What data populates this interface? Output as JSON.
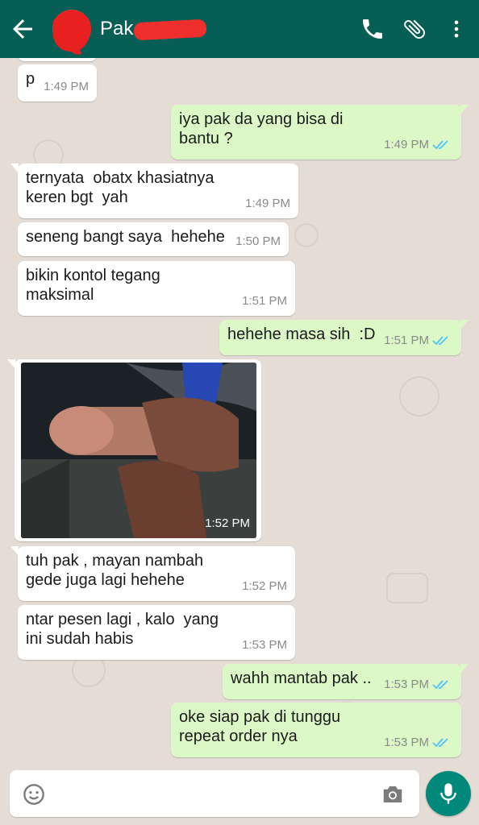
{
  "header": {
    "title": "Pak",
    "bg_color": "#075e54",
    "icons": [
      "back-arrow-icon",
      "call-icon",
      "attach-icon",
      "more-vert-icon"
    ]
  },
  "messages": [
    {
      "dir": "in",
      "text": "",
      "time": ""
    },
    {
      "dir": "in",
      "text": "p",
      "time": "1:49 PM"
    },
    {
      "dir": "out",
      "text": "iya pak da yang bisa di\nbantu ?",
      "time": "1:49 PM"
    },
    {
      "dir": "in",
      "text": "ternyata  obatx khasiatnya\nkeren bgt  yah",
      "time": "1:49 PM"
    },
    {
      "dir": "in",
      "text": "seneng bangt saya  hehehe",
      "time": "1:50 PM"
    },
    {
      "dir": "in",
      "text": "bikin kontol tegang\nmaksimal",
      "time": "1:51 PM"
    },
    {
      "dir": "out",
      "text": "hehehe masa sih  :D",
      "time": "1:51 PM"
    },
    {
      "dir": "in",
      "text": "",
      "time": "1:52 PM",
      "kind": "photo"
    },
    {
      "dir": "in",
      "text": "tuh pak , mayan nambah\ngede juga lagi hehehe",
      "time": "1:52 PM"
    },
    {
      "dir": "in",
      "text": "ntar pesen lagi , kalo  yang\nini sudah habis",
      "time": "1:53 PM"
    },
    {
      "dir": "out",
      "text": "wahh mantab pak ..",
      "time": "1:53 PM"
    },
    {
      "dir": "out",
      "text": "oke siap pak di tunggu\nrepeat order nya",
      "time": "1:53 PM"
    }
  ],
  "composer": {
    "placeholder": "",
    "icons": [
      "emoji-icon",
      "camera-icon",
      "mic-icon"
    ],
    "accent_color": "#00897b"
  },
  "colors": {
    "incoming": "#ffffff",
    "outgoing": "#dcf8c6",
    "read_ticks": "#4fc3f7",
    "chat_bg": "#e5ddd5"
  }
}
